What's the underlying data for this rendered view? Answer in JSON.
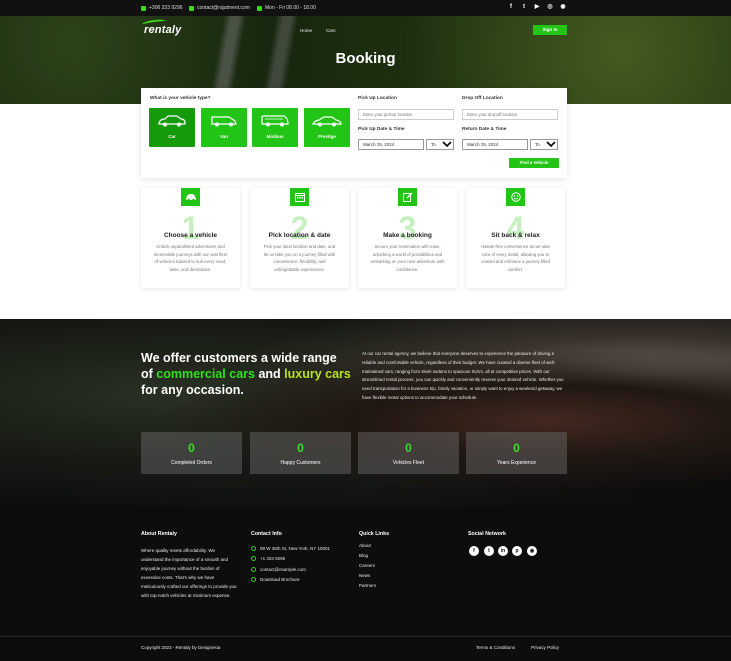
{
  "topbar": {
    "phone": "+306 333 9296",
    "email": "contact@rajutment.com",
    "hours": "Mon - Fri 08.00 - 18.00",
    "socials": [
      "f",
      "t",
      "▶",
      "◎",
      "◉"
    ]
  },
  "header": {
    "logo": "rentaly",
    "nav": [
      "Home",
      "Cars"
    ],
    "signin": "Sign In",
    "title": "Booking"
  },
  "booking": {
    "vehicle_type_label": "What is your vehicle type?",
    "vehicle_types": [
      "Car",
      "Van",
      "Minibus",
      "Prestige"
    ],
    "pickup_location_label": "Pick Up Location",
    "pickup_location_placeholder": "Enter your pickup location",
    "dropoff_location_label": "Drop Off Location",
    "dropoff_location_placeholder": "Enter your dropoff location",
    "pickup_datetime_label": "Pick Up Date & Time",
    "pickup_date": "March 29, 2024",
    "pickup_time": "To",
    "return_datetime_label": "Return Date & Time",
    "return_date": "March 29, 2024",
    "return_time": "To",
    "find_button": "Find a Vehicle"
  },
  "steps": [
    {
      "num": "1",
      "title": "Choose a vehicle",
      "desc": "Unlock unparalleled adventures and memorable journeys with our vast fleet of vehicles tailored to suit every need, taste, and destination."
    },
    {
      "num": "2",
      "title": "Pick location & date",
      "desc": "Pick your ideal location and date, and let us take you on a journey filled with convenience, flexibility, and unforgettable experiences."
    },
    {
      "num": "3",
      "title": "Make a booking",
      "desc": "Secure your reservation with ease, unlocking a world of possibilities and embarking on your next adventure with confidence."
    },
    {
      "num": "4",
      "title": "Sit back & relax",
      "desc": "Hassle-free convenience as we take care of every detail, allowing you to unwind and embrace a journey filled comfort."
    }
  ],
  "offer": {
    "head_1": "We offer customers a wide range of ",
    "head_green": "commercial cars",
    "head_2": " and ",
    "head_lime": "luxury cars",
    "head_3": " for any occasion.",
    "text": "At our car rental agency, we believe that everyone deserves to experience the pleasure of driving a reliable and comfortable vehicle, regardless of their budget. We have curated a diverse fleet of well-maintained cars, ranging from sleek sedans to spacious SUVs, all at competitive prices. With our streamlined rental process, you can quickly and conveniently reserve your desired vehicle. Whether you need transportation for a business trip, family vacation, or simply want to enjoy a weekend getaway, we have flexible rental options to accommodate your schedule."
  },
  "stats": [
    {
      "value": "0",
      "label": "Completed Orders"
    },
    {
      "value": "0",
      "label": "Happy Customers"
    },
    {
      "value": "0",
      "label": "Vehicles Fleet"
    },
    {
      "value": "0",
      "label": "Years Experience"
    }
  ],
  "footer": {
    "about_title": "About Rentaly",
    "about_text": "Where quality meets affordability. We understand the importance of a smooth and enjoyable journey without the burden of excessive costs. That's why we have meticulously crafted our offerings to provide you with top-notch vehicles at minimum expense.",
    "contact_title": "Contact Info",
    "contact": [
      "08 W 36th St, New York, NY 10001",
      "+1 333 9296",
      "contact@example.com",
      "Download Brochure"
    ],
    "links_title": "Quick Links",
    "links": [
      "About",
      "Blog",
      "Careers",
      "News",
      "Partners"
    ],
    "social_title": "Social Network",
    "socials": [
      "f",
      "t",
      "in",
      "p",
      "◉"
    ],
    "copyright": "Copyright 2023 - Rentaly by Designesia",
    "terms": "Terms & Conditions",
    "privacy": "Privacy Policy"
  },
  "colors": {
    "accent": "#22c416",
    "accent_dark": "#159a0c",
    "lime": "#b7e51c",
    "footer_bg": "#0d0d0d"
  }
}
